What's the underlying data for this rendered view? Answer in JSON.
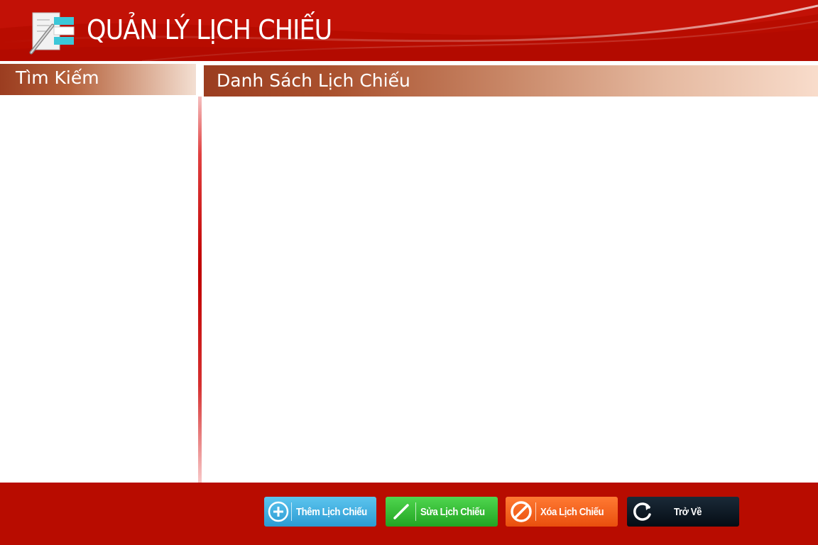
{
  "header": {
    "title": "QUẢN LÝ LỊCH CHIẾU",
    "icon": "schedule-edit-icon"
  },
  "search_panel": {
    "title": "Tìm Kiếm"
  },
  "list_panel": {
    "title": "Danh Sách Lịch Chiếu"
  },
  "footer": {
    "buttons": {
      "add": {
        "label": "Thêm Lịch Chiếu",
        "icon": "plus-circle-icon",
        "color": "#2c9bd3"
      },
      "edit": {
        "label": "Sửa Lịch Chiếu",
        "icon": "pencil-icon",
        "color": "#22a422"
      },
      "delete": {
        "label": "Xóa Lịch Chiếu",
        "icon": "prohibit-icon",
        "color": "#e94f0d"
      },
      "back": {
        "label": "Trở Về",
        "icon": "refresh-icon",
        "color": "#050c14"
      }
    }
  },
  "colors": {
    "brand_red": "#b80c00",
    "panel_header_brown": "#9b3d20"
  }
}
